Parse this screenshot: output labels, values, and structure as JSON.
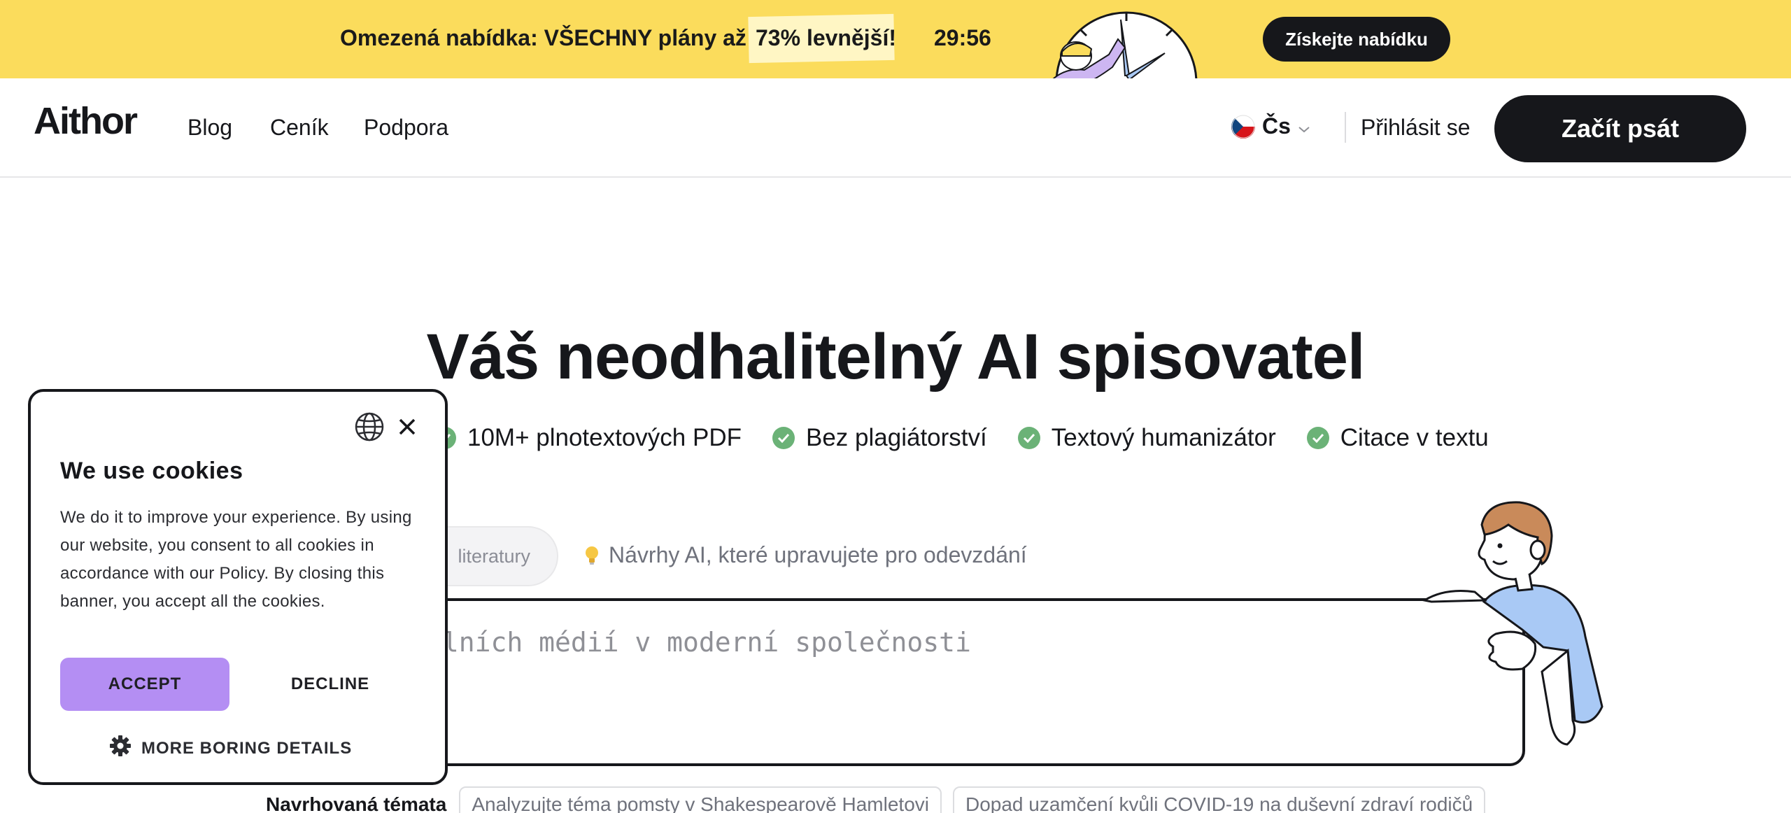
{
  "promo": {
    "text": "Omezená nabídka: VŠECHNY plány až o",
    "highlight": "73% levnější!",
    "timer": "29:56",
    "button_label": "Získejte nabídku",
    "colors": {
      "background": "#fbdc5c",
      "highlight": "#fff6c4"
    }
  },
  "header": {
    "logo": "Aithor",
    "nav": [
      "Blog",
      "Ceník",
      "Podpora"
    ],
    "language": "Čs",
    "login_label": "Přihlásit se",
    "cta_label": "Začít psát",
    "icons": {
      "flag": "czech-flag-icon",
      "dropdown": "chevron-down-icon"
    }
  },
  "hero": {
    "title": "Váš neodhalitelný AI spisovatel",
    "features": [
      "10M+ plnotextových PDF",
      "Bez plagiátorství",
      "Textový humanizátor",
      "Citace v textu"
    ],
    "chip_partial": "literatury",
    "tip": "Návrhy AI, které upravujete pro odevzdání",
    "input_value": "álních médií v moderní společnosti",
    "suggested_label": "Navrhovaná témata",
    "suggested_topics": [
      "Analyzujte téma pomsty v Shakespearově Hamletovi",
      "Dopad uzamčení kvůli COVID-19 na duševní zdraví rodičů"
    ],
    "colors": {
      "check": "#6bb277",
      "input_border": "#16171b"
    }
  },
  "cookie": {
    "title": "We use cookies",
    "body": "We do it to improve your experience. By using our website, you consent to all cookies in accordance with our Policy. By closing this banner, you accept all the cookies.",
    "accept_label": "ACCEPT",
    "decline_label": "DECLINE",
    "more_label": "MORE BORING DETAILS",
    "icons": {
      "language": "globe-icon",
      "close": "close-icon",
      "settings": "gear-icon"
    },
    "colors": {
      "accept": "#b48ef3"
    }
  }
}
